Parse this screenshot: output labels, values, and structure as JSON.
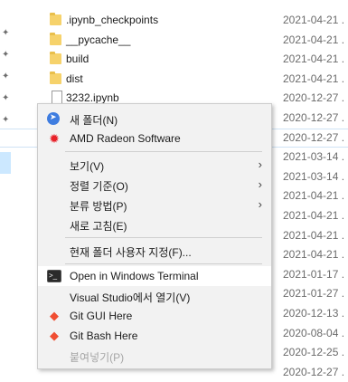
{
  "files": [
    {
      "name": ".ipynb_checkpoints",
      "date": "2021-04-21 .",
      "type": "folder"
    },
    {
      "name": "__pycache__",
      "date": "2021-04-21 .",
      "type": "folder"
    },
    {
      "name": "build",
      "date": "2021-04-21 .",
      "type": "folder"
    },
    {
      "name": "dist",
      "date": "2021-04-21 .",
      "type": "folder"
    },
    {
      "name": "3232.ipynb",
      "date": "2020-12-27 .",
      "type": "file"
    },
    {
      "name": "",
      "date": "2020-12-27 .",
      "type": "hidden"
    },
    {
      "name": "",
      "date": "2020-12-27 .",
      "type": "hidden"
    },
    {
      "name": "",
      "date": "2021-03-14 .",
      "type": "hidden"
    },
    {
      "name": "",
      "date": "2021-03-14 .",
      "type": "hidden"
    },
    {
      "name": "",
      "date": "2021-04-21 .",
      "type": "hidden"
    },
    {
      "name": "",
      "date": "2021-04-21 .",
      "type": "hidden"
    },
    {
      "name": "",
      "date": "2021-04-21 .",
      "type": "hidden"
    },
    {
      "name": "",
      "date": "2021-04-21 .",
      "type": "hidden"
    },
    {
      "name": "",
      "date": "2021-01-17 .",
      "type": "hidden"
    },
    {
      "name": "",
      "date": "2021-01-27 .",
      "type": "hidden"
    },
    {
      "name": "",
      "date": "2020-12-13 .",
      "type": "hidden"
    },
    {
      "name": "",
      "date": "2020-08-04 .",
      "type": "hidden"
    },
    {
      "name": "",
      "date": "2020-12-25 .",
      "type": "hidden"
    },
    {
      "name": "",
      "date": "2020-12-27 .",
      "type": "hidden"
    }
  ],
  "context_menu": {
    "items": [
      {
        "label": "새 폴더(N)",
        "icon": "globe-arrow-icon"
      },
      {
        "label": "AMD Radeon Software",
        "icon": "amd-icon"
      },
      {
        "label": "보기(V)",
        "submenu": true
      },
      {
        "label": "정렬 기준(O)",
        "submenu": true
      },
      {
        "label": "분류 방법(P)",
        "submenu": true
      },
      {
        "label": "새로 고침(E)"
      },
      {
        "label": "현재 폴더 사용자 지정(F)..."
      },
      {
        "label": "Open in Windows Terminal",
        "icon": "terminal-icon"
      },
      {
        "label": "Visual Studio에서 열기(V)"
      },
      {
        "label": "Git GUI Here",
        "icon": "git-gui-icon"
      },
      {
        "label": "Git Bash Here",
        "icon": "git-bash-icon"
      },
      {
        "label": "붙여넣기(P)",
        "disabled": true
      }
    ],
    "submenu_arrow": "›",
    "terminal_glyph": ">_"
  },
  "colors": {
    "menu_bg": "#f2f2f2",
    "hover_bg": "#ffffff",
    "folder": "#f6d26b",
    "accent": "#3f7de0",
    "amd_red": "#e8222a",
    "git_red": "#f04e32"
  }
}
